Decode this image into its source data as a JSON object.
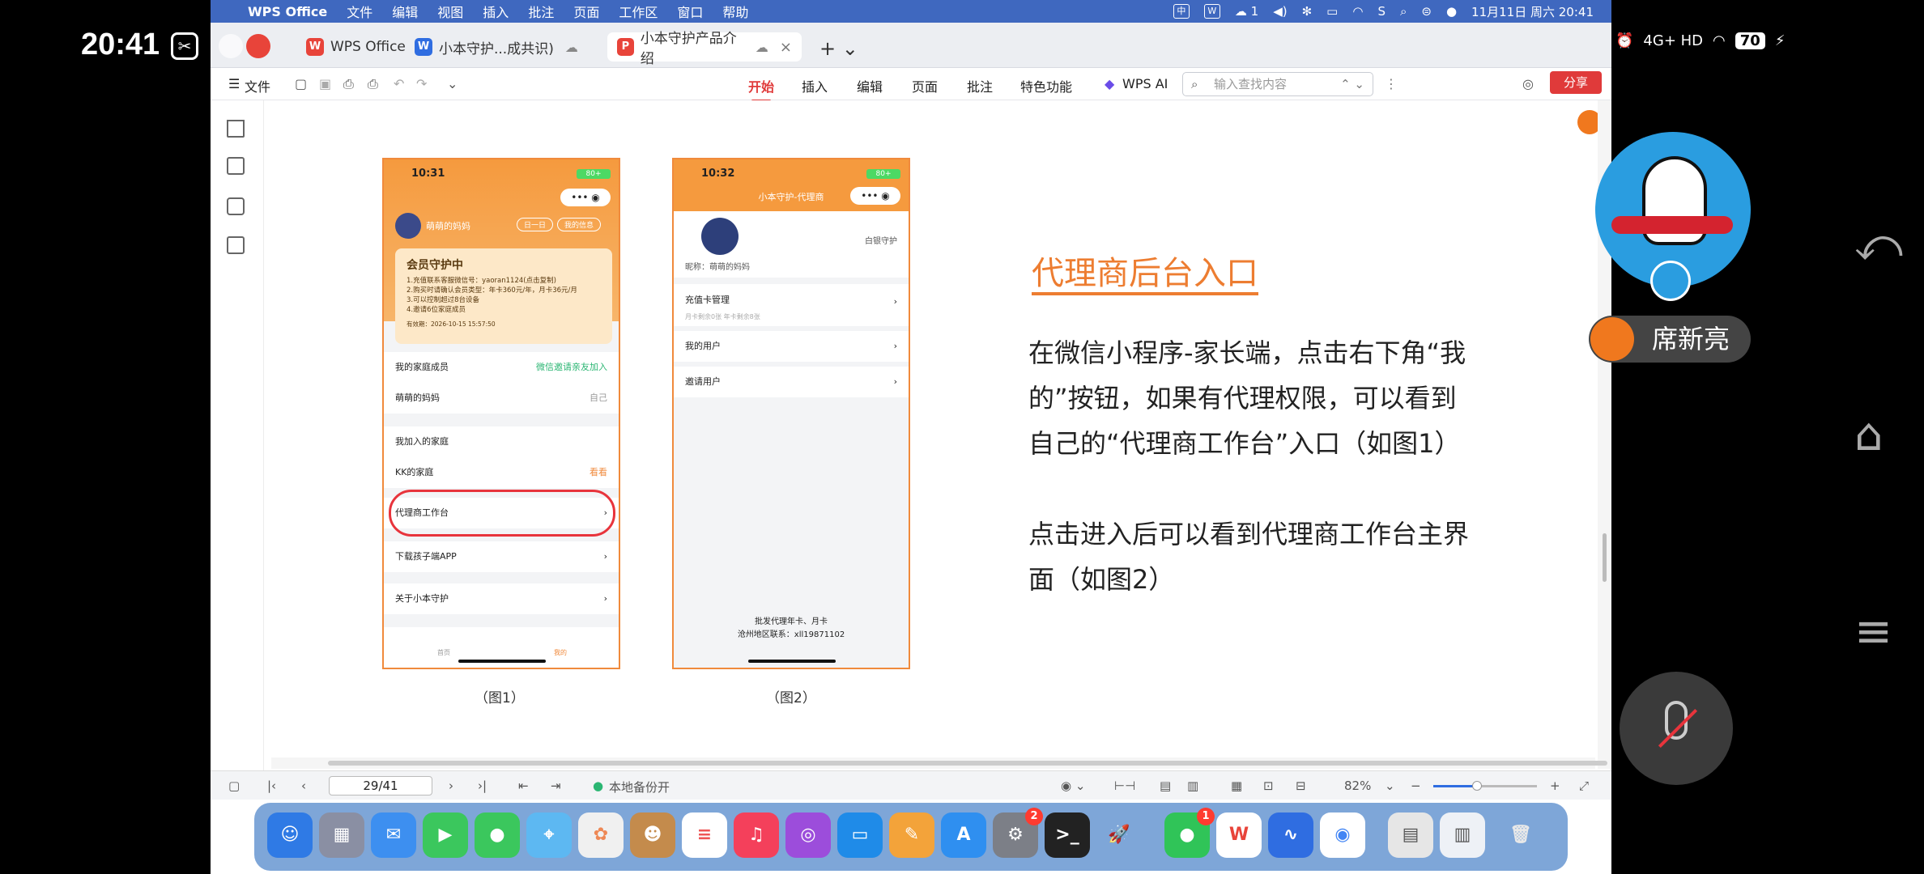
{
  "phone_status": {
    "time": "20:41",
    "battery": "70",
    "network": "4G+ HD"
  },
  "menubar": {
    "app_name": "WPS Office",
    "items": [
      "文件",
      "编辑",
      "视图",
      "插入",
      "批注",
      "页面",
      "工作区",
      "窗口",
      "帮助"
    ],
    "wifi_count": "1",
    "datetime": "11月11日 周六 20:41"
  },
  "tabs": [
    {
      "label": "WPS Office"
    },
    {
      "label": "小本守护...成共识)"
    },
    {
      "label": "小本守护产品介绍"
    }
  ],
  "toolbar": {
    "file_label": "文件",
    "ribbon": [
      "开始",
      "插入",
      "编辑",
      "页面",
      "批注",
      "特色功能"
    ],
    "wps_ai": "WPS AI",
    "search_placeholder": "输入查找内容",
    "share_label": "分享"
  },
  "slide": {
    "title": "代理商后台入口",
    "para1": "在微信小程序-家长端，点击右下角“我的”按钮，如果有代理权限，可以看到自己的“代理商工作台”入口（如图1）",
    "para2": "点击进入后可以看到代理商工作台主界面（如图2）",
    "caption1": "（图1）",
    "caption2": "（图2）"
  },
  "phone1": {
    "time": "10:31",
    "battery": "80+",
    "user": "萌萌的妈妈",
    "chip1": "日一日",
    "chip2": "我的信息",
    "card_title": "会员守护中",
    "card_lines": [
      "1.充值联系客服微信号：yaoran1124(点击复制)",
      "2.购买时请确认会员类型：年卡360元/年，月卡36元/月",
      "3.可以控制超过8台设备",
      "4.邀请6位家庭成员"
    ],
    "card_date": "有效期：2026-10-15 15:57:50",
    "rows": [
      {
        "label": "我的家庭成员",
        "right": "微信邀请亲友加入"
      },
      {
        "label": "萌萌的妈妈",
        "right": "自己"
      },
      {
        "label": "我加入的家庭",
        "right": ""
      },
      {
        "label": "KK的家庭",
        "right": "看看"
      },
      {
        "label": "代理商工作台",
        "right": "›"
      },
      {
        "label": "下载孩子端APP",
        "right": "›"
      },
      {
        "label": "关于小本守护",
        "right": "›"
      }
    ],
    "tab_home": "首页",
    "tab_mine": "我的"
  },
  "phone2": {
    "time": "10:32",
    "header": "小本守护-代理商",
    "nickname": "昵称：萌萌的妈妈",
    "badge": "白银守护",
    "rows": [
      {
        "label": "充值卡管理",
        "sub": "月卡剩余0张 年卡剩余8张"
      },
      {
        "label": "我的用户",
        "sub": ""
      },
      {
        "label": "邀请用户",
        "sub": ""
      }
    ],
    "footer1": "批发代理年卡、月卡",
    "footer2": "沧州地区联系：xll19871102"
  },
  "statusbar": {
    "page": "29/41",
    "backup": "本地备份开",
    "zoom": "82%"
  },
  "meeting": {
    "speaker": "席新亮"
  },
  "dock_badges": {
    "settings": "2",
    "wechat": "1"
  }
}
